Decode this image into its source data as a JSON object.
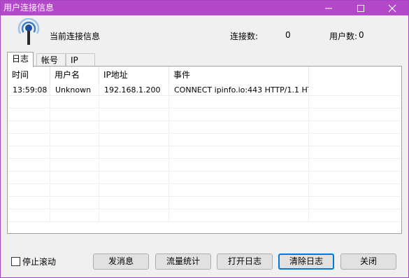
{
  "window": {
    "title": "用户连接信息"
  },
  "header": {
    "heading": "当前连接信息",
    "connections_label": "连接数:",
    "connections_value": "0",
    "users_label": "用户数:",
    "users_value": "0"
  },
  "tabs": [
    {
      "label": "日志",
      "active": true
    },
    {
      "label": "帐号",
      "active": false
    },
    {
      "label": "IP",
      "active": false
    }
  ],
  "table": {
    "columns": [
      "时间",
      "用户名",
      "IP地址",
      "事件"
    ],
    "rows": [
      [
        "13:59:08",
        "Unknown",
        "192.168.1.200",
        "CONNECT ipinfo.io:443 HTTP/1.1 HT..."
      ]
    ]
  },
  "footer": {
    "stop_scroll_label": "停止滚动",
    "stop_scroll_checked": false,
    "buttons": {
      "send_message": "发消息",
      "traffic_stats": "流量统计",
      "open_log": "打开日志",
      "clear_log": "清除日志",
      "close": "关闭"
    }
  }
}
